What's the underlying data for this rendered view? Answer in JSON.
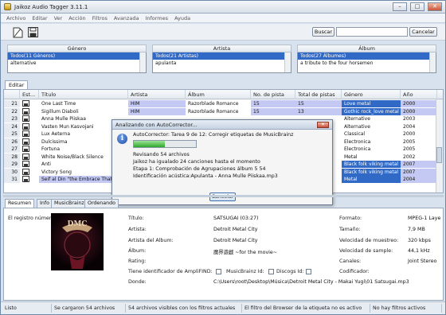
{
  "window": {
    "title": "Jaikoz Audio Tagger 3.11.1"
  },
  "menu": [
    "Archivo",
    "Editar",
    "Ver",
    "Acción",
    "Filtros",
    "Avanzada",
    "Informes",
    "Ayuda"
  ],
  "search": {
    "button": "Buscar",
    "value": "",
    "cancel": "Cancelar"
  },
  "browser": {
    "genre": {
      "header": "Género",
      "items": [
        "Todos(11 Géneros)",
        "alternative"
      ]
    },
    "artist": {
      "header": "Artista",
      "items": [
        "Todos(21 Artistas)",
        "apulanta"
      ]
    },
    "album": {
      "header": "Álbum",
      "items": [
        "Todos(27 Álbumes)",
        "a tribute to the four horsemen"
      ]
    }
  },
  "edit_tab": "Editar",
  "table": {
    "headers": [
      "Est...",
      "Título",
      "Artista",
      "Álbum",
      "No. de pista",
      "Total de pistas",
      "Género",
      "Año"
    ],
    "rows": [
      {
        "n": "21",
        "title": "One Last Time",
        "artist": "HIM",
        "album": "Razorblade Romance",
        "track": "15",
        "total": "15",
        "genre": "Love metal",
        "year": "2000",
        "hl": true
      },
      {
        "n": "22",
        "title": "Sigillum Diaboli",
        "artist": "HIM",
        "album": "Razorblade Romance",
        "track": "15",
        "total": "13",
        "genre": "Gothic rock_love metal",
        "year": "2000",
        "hl": true
      },
      {
        "n": "23",
        "title": "Anna Mulle Piiskaa",
        "artist": "",
        "album": "",
        "track": "",
        "total": "",
        "genre": "Alternative",
        "year": "2003",
        "hl": false
      },
      {
        "n": "24",
        "title": "Vasten Mun Kasvojani",
        "artist": "",
        "album": "",
        "track": "",
        "total": "",
        "genre": "Alternative",
        "year": "2004",
        "hl": false
      },
      {
        "n": "25",
        "title": "Lux Aeterna",
        "artist": "",
        "album": "",
        "track": "",
        "total": "",
        "genre": "Classical",
        "year": "2000",
        "hl": false
      },
      {
        "n": "26",
        "title": "Dulcissima",
        "artist": "",
        "album": "",
        "track": "",
        "total": "",
        "genre": "Electronica",
        "year": "2005",
        "hl": false
      },
      {
        "n": "27",
        "title": "Fortuna",
        "artist": "",
        "album": "",
        "track": "",
        "total": "",
        "genre": "Electronica",
        "year": "2005",
        "hl": false
      },
      {
        "n": "28",
        "title": "White Noise/Black Silence",
        "artist": "",
        "album": "",
        "track": "",
        "total": "",
        "genre": "Metal",
        "year": "2002",
        "hl": false
      },
      {
        "n": "29",
        "title": "Anti",
        "artist": "",
        "album": "",
        "track": "",
        "total": "",
        "genre": "Black folk viking metal",
        "year": "2007",
        "hl": true
      },
      {
        "n": "30",
        "title": "Victory Song",
        "artist": "",
        "album": "",
        "track": "",
        "total": "",
        "genre": "Black folk viking metal",
        "year": "2007",
        "hl": true
      },
      {
        "n": "31",
        "title": "Seif al Din \"the Embrace That Smothers (Part",
        "artist": "",
        "album": "",
        "track": "",
        "total": "",
        "genre": "Metal",
        "year": "2004",
        "hl": true
      }
    ]
  },
  "dialog": {
    "title": "Analizando con AutoCorrector...",
    "line1": "AutoCorrector: Tarea 9 de 12: Corregir etiquetas de MusicBrainz",
    "progress": 0.5,
    "line2": "Revisando 54 archivos",
    "line3": "Jaikoz ha igualado 24 canciones hasta el momento",
    "line4": "Etapa 1: Comprobación de Agrupaciones álbum 5 54",
    "line5": "Identificación acústica:Apulanta - Anna Mulle Piiskaa.mp3",
    "cancel": "Cancelar"
  },
  "bottom_tabs": [
    "Resumen",
    "Info",
    "MusicBrainz",
    "Ordenando"
  ],
  "detail": {
    "record": "El registro número:0",
    "cover_text": "DMC",
    "labels": {
      "title": "Título:",
      "artist": "Artista:",
      "album_artist": "Artista del Album:",
      "album": "Álbum:",
      "rating": "Rating:",
      "amplifind": "Tiene identificador de AmpliFIND:",
      "mb_id": "MusicBrainz Id:",
      "discogs": "Discogs Id:",
      "where": "Donde:",
      "format": "Formato:",
      "size": "Tamaño:",
      "sample_rate": "Velocidad de muestreo:",
      "bitrate": "Velocidad de sample:",
      "channels": "Canales:",
      "encoder": "Codificador:"
    },
    "values": {
      "title": "SATSUGAI (03:27)",
      "artist": "Detroit Metal City",
      "album_artist": "Detroit Metal City",
      "album": "魔界遊戯 ~for the movie~",
      "where": "C:\\Users\\root\\Desktop\\Música\\Detroit Metal City - Makai Yugi\\01 Satsugai.mp3",
      "format": "MPEG-1 Laye",
      "size": "7,9 MB",
      "sample_rate": "320 kbps",
      "bitrate": "44,1 kHz",
      "channels": "Joint Stereo",
      "encoder": ""
    }
  },
  "status": [
    "Listo",
    "Se cargaron 54 archivos",
    "54 archivos visibles con los filtros actuales",
    "El filtro del Browser de la etiqueta no es activo",
    "No hay filtros activos"
  ],
  "colors": {
    "selection": "#3169c6",
    "highlight_cell": "#c3c9f2",
    "progress": "#2ea82a"
  }
}
